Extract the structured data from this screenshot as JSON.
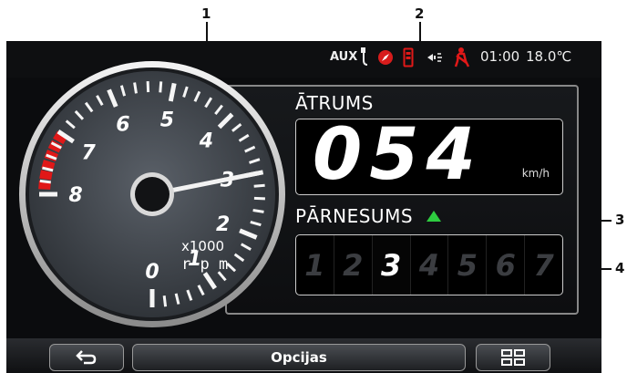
{
  "callouts": [
    "1",
    "2",
    "3",
    "4"
  ],
  "status_bar": {
    "aux_label": "AUX",
    "time": "01:00",
    "temperature": "18.0℃",
    "icons": [
      "aux-plug-icon",
      "compass-icon",
      "phone-battery-icon",
      "bluetooth-audio-icon",
      "seatbelt-warning-icon"
    ]
  },
  "tachometer": {
    "tick_labels": [
      "0",
      "1",
      "2",
      "3",
      "4",
      "5",
      "6",
      "7",
      "8"
    ],
    "unit_line1": "x1000",
    "unit_line2": "r p m",
    "needle_value_krpm": 3,
    "redline_from_krpm": 7
  },
  "speed": {
    "label": "ĀTRUMS",
    "value": "054",
    "unit": "km/h"
  },
  "gear": {
    "label": "PĀRNESUMS",
    "shift_indicator": "up-arrow",
    "gears": [
      "1",
      "2",
      "3",
      "4",
      "5",
      "6",
      "7"
    ],
    "current": "3"
  },
  "toolbar": {
    "back_icon": "back-arrow-icon",
    "options_label": "Opcijas",
    "menu_icon": "grid-menu-icon"
  },
  "colors": {
    "accent_red": "#e01818",
    "gear_up_green": "#2ecc40"
  }
}
